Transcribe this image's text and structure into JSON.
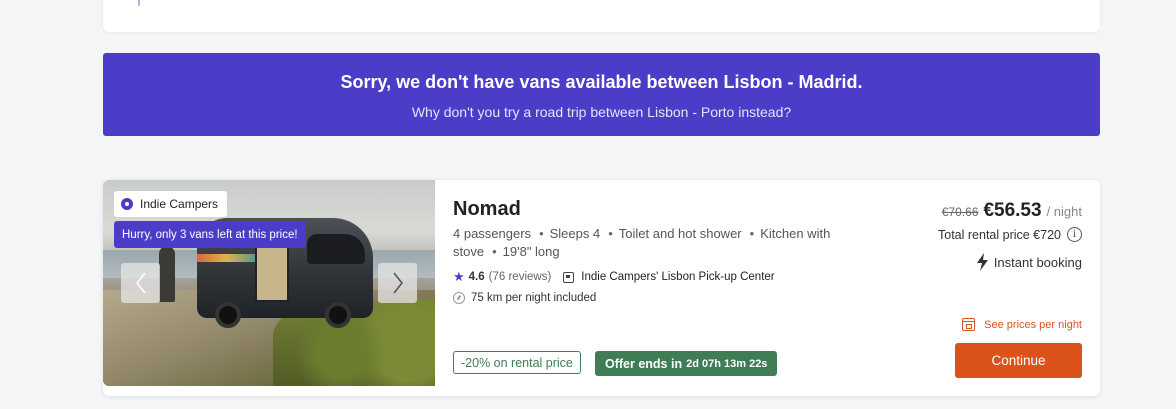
{
  "banner": {
    "title": "Sorry, we don't have vans available between Lisbon - Madrid.",
    "subtitle": "Why don't you try a road trip between Lisbon - Porto instead?"
  },
  "listing": {
    "brand": "Indie Campers",
    "urgency": "Hurry, only 3 vans left at this price!",
    "name": "Nomad",
    "features": [
      "4 passengers",
      "Sleeps 4",
      "Toilet and hot shower",
      "Kitchen with stove",
      "19'8\" long"
    ],
    "rating": "4.6",
    "reviews": "(76 reviews)",
    "location": "Indie Campers' Lisbon Pick-up Center",
    "km_included": "75 km per night included",
    "discount": "-20% on rental price",
    "offer_label": "Offer ends in",
    "offer_timer": "2d 07h 13m 22s",
    "old_price": "€70.66",
    "price": "€56.53",
    "per_night": "/ night",
    "total": "Total rental price €720",
    "instant_booking": "Instant booking",
    "see_prices": "See prices per night",
    "continue": "Continue"
  },
  "icons": {
    "brand": "brand-logo-icon",
    "prev": "chevron-left-icon",
    "next": "chevron-right-icon",
    "star": "star-icon",
    "location": "location-icon",
    "km": "odometer-icon",
    "info": "info-icon",
    "bolt": "bolt-icon",
    "calendar": "calendar-icon"
  },
  "colors": {
    "accent": "#4c3dc8",
    "cta": "#dc521b",
    "offer_green": "#3e7d55"
  }
}
